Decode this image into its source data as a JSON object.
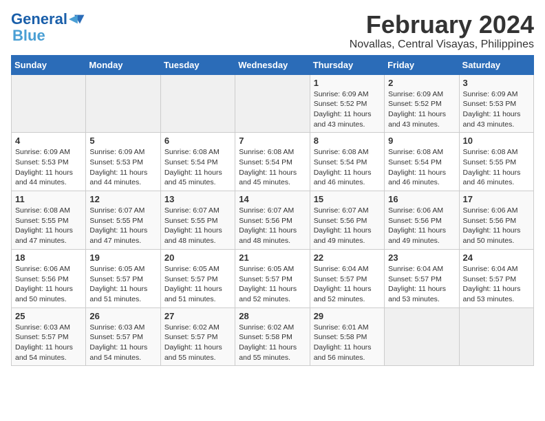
{
  "header": {
    "logo_line1": "General",
    "logo_line2": "Blue",
    "month_year": "February 2024",
    "location": "Novallas, Central Visayas, Philippines"
  },
  "weekdays": [
    "Sunday",
    "Monday",
    "Tuesday",
    "Wednesday",
    "Thursday",
    "Friday",
    "Saturday"
  ],
  "weeks": [
    [
      {
        "day": "",
        "info": ""
      },
      {
        "day": "",
        "info": ""
      },
      {
        "day": "",
        "info": ""
      },
      {
        "day": "",
        "info": ""
      },
      {
        "day": "1",
        "info": "Sunrise: 6:09 AM\nSunset: 5:52 PM\nDaylight: 11 hours and 43 minutes."
      },
      {
        "day": "2",
        "info": "Sunrise: 6:09 AM\nSunset: 5:52 PM\nDaylight: 11 hours and 43 minutes."
      },
      {
        "day": "3",
        "info": "Sunrise: 6:09 AM\nSunset: 5:53 PM\nDaylight: 11 hours and 43 minutes."
      }
    ],
    [
      {
        "day": "4",
        "info": "Sunrise: 6:09 AM\nSunset: 5:53 PM\nDaylight: 11 hours and 44 minutes."
      },
      {
        "day": "5",
        "info": "Sunrise: 6:09 AM\nSunset: 5:53 PM\nDaylight: 11 hours and 44 minutes."
      },
      {
        "day": "6",
        "info": "Sunrise: 6:08 AM\nSunset: 5:54 PM\nDaylight: 11 hours and 45 minutes."
      },
      {
        "day": "7",
        "info": "Sunrise: 6:08 AM\nSunset: 5:54 PM\nDaylight: 11 hours and 45 minutes."
      },
      {
        "day": "8",
        "info": "Sunrise: 6:08 AM\nSunset: 5:54 PM\nDaylight: 11 hours and 46 minutes."
      },
      {
        "day": "9",
        "info": "Sunrise: 6:08 AM\nSunset: 5:54 PM\nDaylight: 11 hours and 46 minutes."
      },
      {
        "day": "10",
        "info": "Sunrise: 6:08 AM\nSunset: 5:55 PM\nDaylight: 11 hours and 46 minutes."
      }
    ],
    [
      {
        "day": "11",
        "info": "Sunrise: 6:08 AM\nSunset: 5:55 PM\nDaylight: 11 hours and 47 minutes."
      },
      {
        "day": "12",
        "info": "Sunrise: 6:07 AM\nSunset: 5:55 PM\nDaylight: 11 hours and 47 minutes."
      },
      {
        "day": "13",
        "info": "Sunrise: 6:07 AM\nSunset: 5:55 PM\nDaylight: 11 hours and 48 minutes."
      },
      {
        "day": "14",
        "info": "Sunrise: 6:07 AM\nSunset: 5:56 PM\nDaylight: 11 hours and 48 minutes."
      },
      {
        "day": "15",
        "info": "Sunrise: 6:07 AM\nSunset: 5:56 PM\nDaylight: 11 hours and 49 minutes."
      },
      {
        "day": "16",
        "info": "Sunrise: 6:06 AM\nSunset: 5:56 PM\nDaylight: 11 hours and 49 minutes."
      },
      {
        "day": "17",
        "info": "Sunrise: 6:06 AM\nSunset: 5:56 PM\nDaylight: 11 hours and 50 minutes."
      }
    ],
    [
      {
        "day": "18",
        "info": "Sunrise: 6:06 AM\nSunset: 5:56 PM\nDaylight: 11 hours and 50 minutes."
      },
      {
        "day": "19",
        "info": "Sunrise: 6:05 AM\nSunset: 5:57 PM\nDaylight: 11 hours and 51 minutes."
      },
      {
        "day": "20",
        "info": "Sunrise: 6:05 AM\nSunset: 5:57 PM\nDaylight: 11 hours and 51 minutes."
      },
      {
        "day": "21",
        "info": "Sunrise: 6:05 AM\nSunset: 5:57 PM\nDaylight: 11 hours and 52 minutes."
      },
      {
        "day": "22",
        "info": "Sunrise: 6:04 AM\nSunset: 5:57 PM\nDaylight: 11 hours and 52 minutes."
      },
      {
        "day": "23",
        "info": "Sunrise: 6:04 AM\nSunset: 5:57 PM\nDaylight: 11 hours and 53 minutes."
      },
      {
        "day": "24",
        "info": "Sunrise: 6:04 AM\nSunset: 5:57 PM\nDaylight: 11 hours and 53 minutes."
      }
    ],
    [
      {
        "day": "25",
        "info": "Sunrise: 6:03 AM\nSunset: 5:57 PM\nDaylight: 11 hours and 54 minutes."
      },
      {
        "day": "26",
        "info": "Sunrise: 6:03 AM\nSunset: 5:57 PM\nDaylight: 11 hours and 54 minutes."
      },
      {
        "day": "27",
        "info": "Sunrise: 6:02 AM\nSunset: 5:57 PM\nDaylight: 11 hours and 55 minutes."
      },
      {
        "day": "28",
        "info": "Sunrise: 6:02 AM\nSunset: 5:58 PM\nDaylight: 11 hours and 55 minutes."
      },
      {
        "day": "29",
        "info": "Sunrise: 6:01 AM\nSunset: 5:58 PM\nDaylight: 11 hours and 56 minutes."
      },
      {
        "day": "",
        "info": ""
      },
      {
        "day": "",
        "info": ""
      }
    ]
  ]
}
